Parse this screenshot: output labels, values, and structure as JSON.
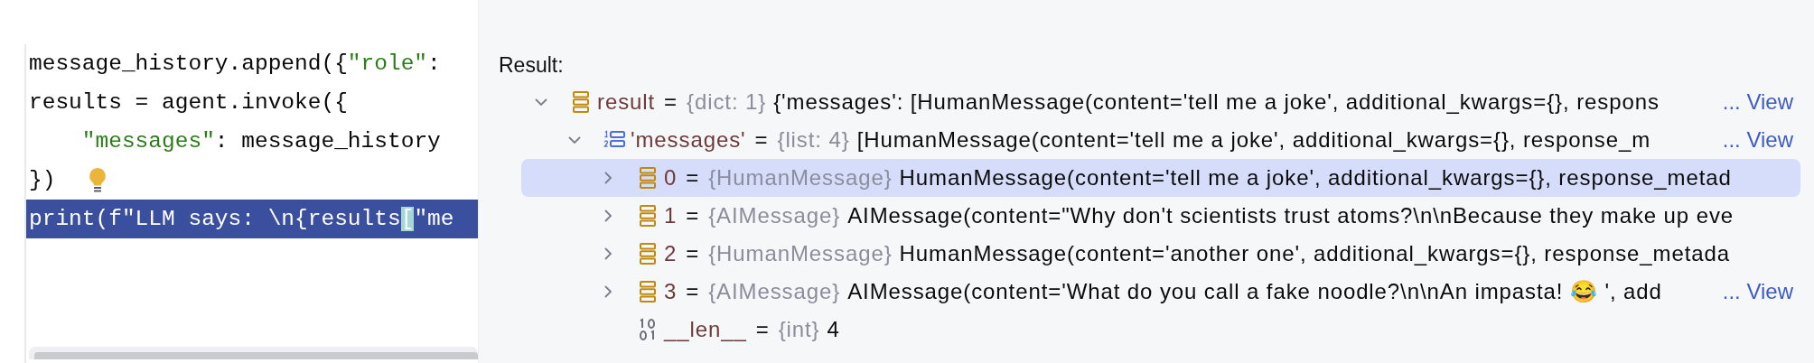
{
  "editor": {
    "lines": [
      {
        "selected": false,
        "bulb": false,
        "tokens": [
          {
            "kind": "plain",
            "text": "message_history.append({"
          },
          {
            "kind": "string",
            "text": "\"role\""
          },
          {
            "kind": "plain",
            "text": ":"
          }
        ]
      },
      {
        "selected": false,
        "bulb": false,
        "tokens": [
          {
            "kind": "plain",
            "text": "results = agent.invoke({"
          }
        ]
      },
      {
        "selected": false,
        "bulb": false,
        "tokens": [
          {
            "kind": "string",
            "text": "    \"messages\""
          },
          {
            "kind": "plain",
            "text": ": message_history"
          }
        ]
      },
      {
        "selected": false,
        "bulb": true,
        "tokens": [
          {
            "kind": "plain",
            "text": "})"
          }
        ]
      },
      {
        "selected": true,
        "bulb": false,
        "tokens": [
          {
            "kind": "plain",
            "text": "print(f\"LLM says: \\n{results"
          },
          {
            "kind": "bracket-match",
            "text": "["
          },
          {
            "kind": "plain",
            "text": "\"me"
          }
        ]
      }
    ]
  },
  "result_panel": {
    "title": "Result:",
    "tree": [
      {
        "kind": "dict",
        "name": "result",
        "operator": "=",
        "type": "{dict: 1}",
        "value": "{'messages': [HumanMessage(content='tell me a joke', additional_kwargs={}, respons",
        "link": "... View",
        "expanded": true,
        "selected": false,
        "children": [
          {
            "kind": "list",
            "name": "'messages'",
            "operator": "=",
            "type": "{list: 4}",
            "value": "[HumanMessage(content='tell me a joke', additional_kwargs={}, response_m",
            "link": "... View",
            "expanded": true,
            "selected": false,
            "children": [
              {
                "kind": "object",
                "name": "0",
                "operator": "=",
                "type": "{HumanMessage}",
                "value": "HumanMessage(content='tell me a joke', additional_kwargs={}, response_metad",
                "expanded": false,
                "selected": true
              },
              {
                "kind": "object",
                "name": "1",
                "operator": "=",
                "type": "{AIMessage}",
                "value": "AIMessage(content=\"Why don't scientists trust atoms?\\n\\nBecause they make up eve",
                "expanded": false,
                "selected": false
              },
              {
                "kind": "object",
                "name": "2",
                "operator": "=",
                "type": "{HumanMessage}",
                "value": "HumanMessage(content='another one', additional_kwargs={}, response_metada",
                "expanded": false,
                "selected": false
              },
              {
                "kind": "object",
                "name": "3",
                "operator": "=",
                "type": "{AIMessage}",
                "value": "AIMessage(content='What do you call a fake noodle?\\n\\nAn impasta! 😂 ', add",
                "link": "... View",
                "expanded": false,
                "selected": false
              },
              {
                "kind": "int",
                "name": "__len__",
                "operator": "=",
                "type": "{int}",
                "value": "4"
              }
            ]
          }
        ]
      }
    ]
  }
}
